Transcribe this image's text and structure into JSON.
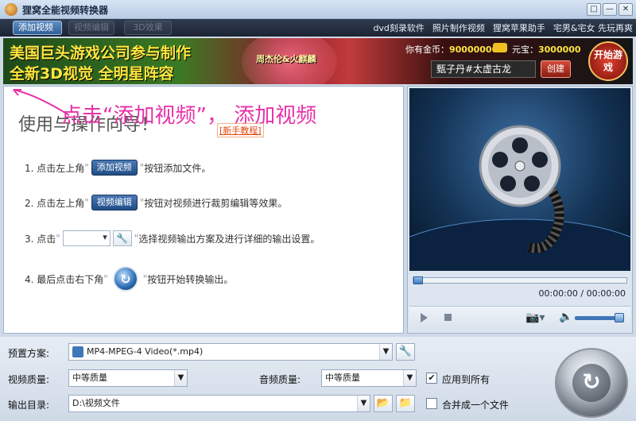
{
  "app": {
    "title": "狸窝全能视频转换器"
  },
  "window_buttons": {
    "restore": "□",
    "minimize": "—",
    "close": "✕"
  },
  "toolbar": {
    "add_video": "添加视频",
    "edit_video": "视频编辑",
    "effect_3d": "3D效果",
    "links": [
      "dvd刻录软件",
      "照片制作视频",
      "狸窝苹果助手",
      "宅男&宅女 先玩再爽"
    ]
  },
  "banner": {
    "line1": "美国巨头游戏公司参与制作",
    "line2": "全新3D视觉 全明星阵容",
    "stars": "周杰伦&火麒麟",
    "gold_label": "你有金币：",
    "gold_value": "90000000",
    "bao_label": "元宝：",
    "bao_value": "3000000",
    "character_name": "甄子丹#太虚古龙",
    "create_button": "创建",
    "start_game": "开始游戏"
  },
  "guide": {
    "title": "使用与操作向导！",
    "tutorial_link": "[新手教程]",
    "annotation": "点击“添加视频”， 添加视频",
    "step1_pre": "1. 点击左上角",
    "step1_btn": "添加视频",
    "step1_post": "按钮添加文件。",
    "step2_pre": "2. 点击左上角",
    "step2_btn": "视频编辑",
    "step2_post": "按钮对视频进行裁剪编辑等效果。",
    "step3_pre": "3. 点击",
    "step3_post": "选择视频输出方案及进行详细的输出设置。",
    "step4_pre": "4. 最后点击右下角",
    "step4_post": "按钮开始转换输出。",
    "quote": "\""
  },
  "preview": {
    "timecode": "00:00:00 / 00:00:00"
  },
  "settings": {
    "preset_label": "预置方案:",
    "preset_value": "MP4-MPEG-4 Video(*.mp4)",
    "video_quality_label": "视频质量:",
    "video_quality_value": "中等质量",
    "audio_quality_label": "音频质量:",
    "audio_quality_value": "中等质量",
    "apply_all_label": "应用到所有",
    "apply_all_checked": true,
    "output_dir_label": "输出目录:",
    "output_dir_value": "D:\\视频文件",
    "merge_label": "合并成一个文件",
    "merge_checked": false
  }
}
